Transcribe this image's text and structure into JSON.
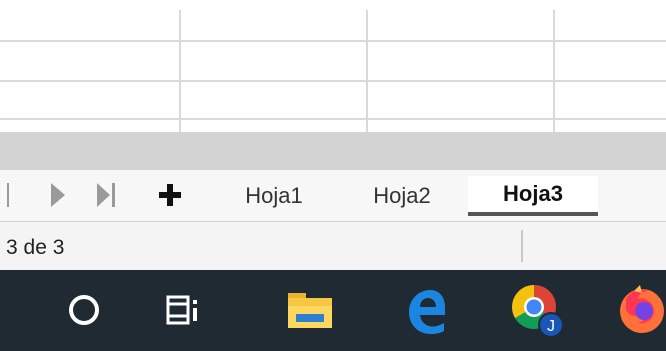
{
  "sheet_tabs": {
    "add_label": "+",
    "tabs": [
      {
        "label": "Hoja1",
        "active": false
      },
      {
        "label": "Hoja2",
        "active": false
      },
      {
        "label": "Hoja3",
        "active": true
      }
    ]
  },
  "navigation": {
    "icons": [
      "first-sheet-icon",
      "next-sheet-icon",
      "last-sheet-icon"
    ]
  },
  "status_bar": {
    "sheet_position": "3 de 3"
  },
  "taskbar": {
    "items": [
      {
        "icon": "cortana-icon"
      },
      {
        "icon": "task-view-icon"
      },
      {
        "icon": "file-explorer-icon"
      },
      {
        "icon": "edge-icon"
      },
      {
        "icon": "chrome-icon",
        "badge": "J"
      },
      {
        "icon": "firefox-icon"
      }
    ]
  },
  "colors": {
    "taskbar_bg": "#1f2a33",
    "grid_line": "#d9d9d9",
    "active_tab_underline": "#555555"
  }
}
